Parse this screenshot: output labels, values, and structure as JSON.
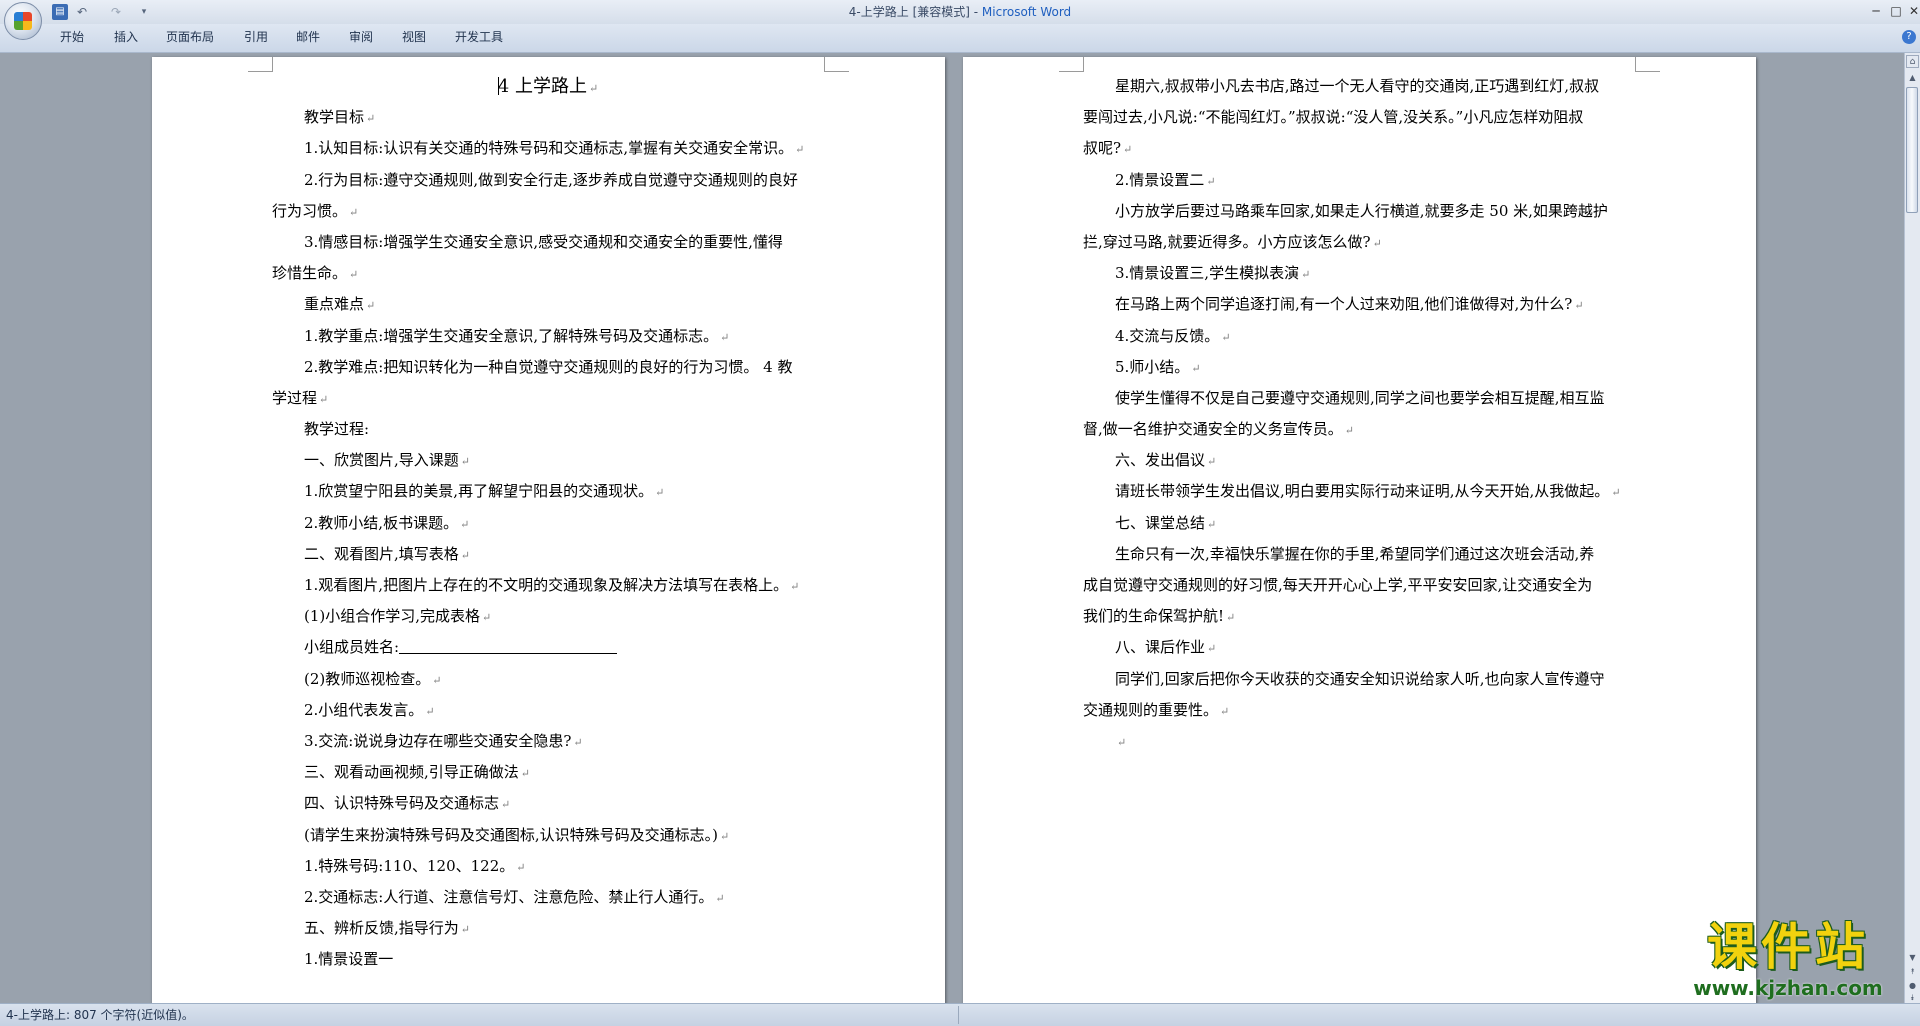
{
  "titlebar": {
    "doc_title": "4-上学路上 [兼容模式] - ",
    "app_name": "Microsoft Word",
    "min": "─",
    "max": "□",
    "close": "✕"
  },
  "quick_access": {
    "save": "▤",
    "undo": "↶ ▾",
    "redo": "↷",
    "dropdown": "▾"
  },
  "ribbon": {
    "tabs": [
      "开始",
      "插入",
      "页面布局",
      "引用",
      "邮件",
      "审阅",
      "视图",
      "开发工具"
    ],
    "help": "?"
  },
  "document": {
    "title": "4  上学路上",
    "left_lines": [
      "教学目标",
      "1.认知目标:认识有关交通的特殊号码和交通标志,掌握有关交通安全常识。",
      "2.行为目标:遵守交通规则,做到安全行走,逐步养成自觉遵守交通规则的良好",
      "行为习惯。",
      "3.情感目标:增强学生交通安全意识,感受交通规和交通安全的重要性,懂得",
      "珍惜生命。",
      "重点难点",
      "1.教学重点:增强学生交通安全意识,了解特殊号码及交通标志。",
      "2.教学难点:把知识转化为一种自觉遵守交通规则的良好的行为习惯。  4 教",
      "学过程",
      "教学过程:",
      "一、欣赏图片,导入课题",
      "1.欣赏望宁阳县的美景,再了解望宁阳县的交通现状。",
      "2.教师小结,板书课题。",
      "二、观看图片,填写表格",
      "1.观看图片,把图片上存在的不文明的交通现象及解决方法填写在表格上。",
      "(1)小组合作学习,完成表格",
      "小组成员姓名:",
      "(2)教师巡视检查。",
      "2.小组代表发言。",
      "3.交流:说说身边存在哪些交通安全隐患?",
      "三、观看动画视频,引导正确做法",
      "四、认识特殊号码及交通标志",
      "(请学生来扮演特殊号码及交通图标,认识特殊号码及交通标志。)",
      "1.特殊号码:110、120、122。",
      "2.交通标志:人行道、注意信号灯、注意危险、禁止行人通行。",
      "五、辨析反馈,指导行为",
      "1.情景设置一"
    ],
    "right_lines": [
      "星期六,叔叔带小凡去书店,路过一个无人看守的交通岗,正巧遇到红灯,叔叔",
      "要闯过去,小凡说:“不能闯红灯。”叔叔说:“没人管,没关系。”小凡应怎样劝阻叔",
      "叔呢?",
      "2.情景设置二",
      "小方放学后要过马路乘车回家,如果走人行横道,就要多走 50 米,如果跨越护",
      "拦,穿过马路,就要近得多。小方应该怎么做?",
      "3.情景设置三,学生模拟表演",
      "在马路上两个同学追逐打闹,有一个人过来劝阻,他们谁做得对,为什么?",
      "4.交流与反馈。",
      "5.师小结。",
      "使学生懂得不仅是自己要遵守交通规则,同学之间也要学会相互提醒,相互监",
      "督,做一名维护交通安全的义务宣传员。",
      "六、发出倡议",
      "请班长带领学生发出倡议,明白要用实际行动来证明,从今天开始,从我做起。",
      "七、课堂总结",
      "生命只有一次,幸福快乐掌握在你的手里,希望同学们通过这次班会活动,养",
      "成自觉遵守交通规则的好习惯,每天开开心心上学,平平安安回家,让交通安全为",
      "我们的生命保驾护航!",
      "八、课后作业",
      "同学们,回家后把你今天收获的交通安全知识说给家人听,也向家人宣传遵守",
      "交通规则的重要性。",
      ""
    ],
    "paragraph_mark": "↵"
  },
  "scrollbar": {
    "ruler": "⌂",
    "up": "▲",
    "down": "▼",
    "prev": "⯭",
    "select": "●",
    "next": "⯯"
  },
  "statusbar": {
    "text": "4-上学路上: 807 个字符(近似值)。"
  },
  "watermark": {
    "text": "课件站",
    "url": "www.kjzhan.com"
  }
}
